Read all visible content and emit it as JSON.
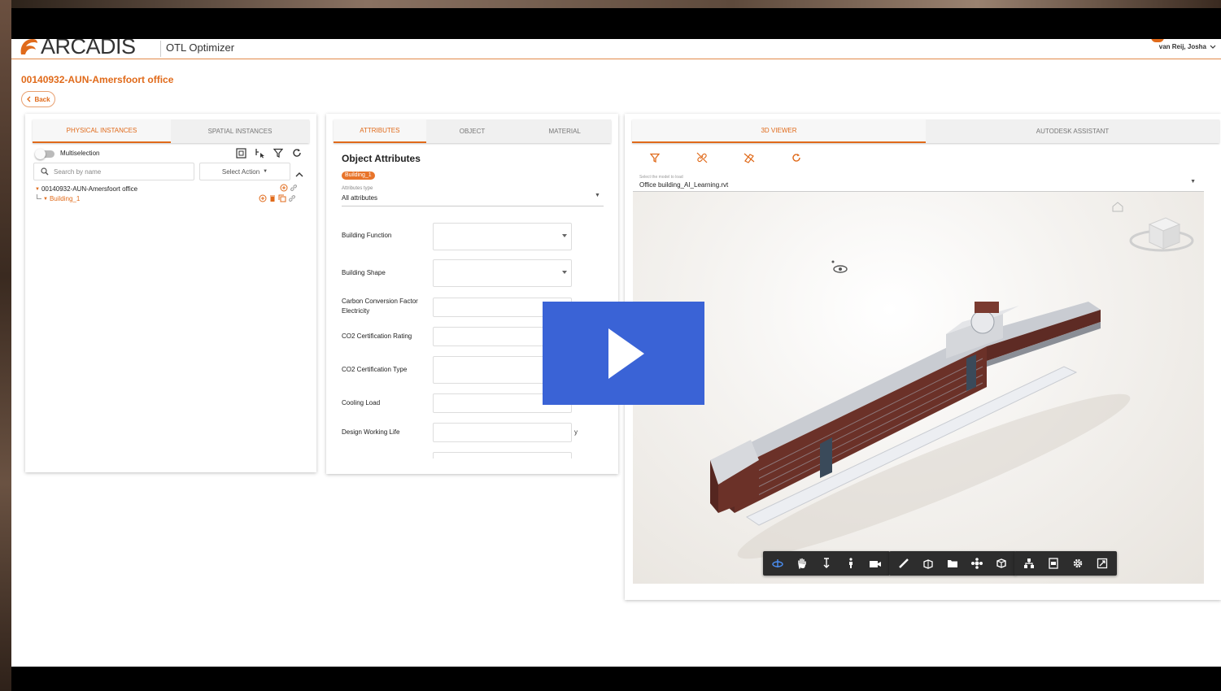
{
  "app": {
    "logo_text": "ARCADIS",
    "app_name": "OTL Optimizer",
    "user_name": "van Reij, Josha",
    "accent_color": "#e06a1a"
  },
  "page": {
    "title": "00140932-AUN-Amersfoort office",
    "back_label": "Back"
  },
  "instances_panel": {
    "tabs": [
      "PHYSICAL INSTANCES",
      "SPATIAL INSTANCES"
    ],
    "active_tab": "PHYSICAL INSTANCES",
    "multiselection_label": "Multiselection",
    "multiselection_on": false,
    "search_placeholder": "Search by name",
    "select_action_label": "Select Action",
    "tree": {
      "root": "00140932-AUN-Amersfoort office",
      "child": "Building_1"
    }
  },
  "attributes_panel": {
    "tabs": [
      "ATTRIBUTES",
      "OBJECT",
      "MATERIAL"
    ],
    "active_tab": "ATTRIBUTES",
    "title": "Object Attributes",
    "badge": "Building_1",
    "attributes_type_label": "Attributes type",
    "attributes_type_value": "All attributes",
    "fields": [
      {
        "label": "Building Function",
        "type": "select",
        "value": "",
        "unit": ""
      },
      {
        "label": "Building Shape",
        "type": "select",
        "value": "",
        "unit": ""
      },
      {
        "label": "Carbon Conversion Factor Electricity",
        "type": "input",
        "value": "",
        "unit": ""
      },
      {
        "label": "CO2 Certification Rating",
        "type": "input",
        "value": "",
        "unit": ""
      },
      {
        "label": "CO2 Certification Type",
        "type": "select",
        "value": "",
        "unit": ""
      },
      {
        "label": "Cooling Load",
        "type": "input",
        "value": "",
        "unit": "kWh"
      },
      {
        "label": "Design Working Life",
        "type": "input",
        "value": "",
        "unit": "y"
      }
    ]
  },
  "viewer_panel": {
    "tabs": [
      "3D VIEWER",
      "AUTODESK ASSISTANT"
    ],
    "active_tab": "3D VIEWER",
    "model_select_label": "Select the model to load",
    "model_select_value": "Office building_AI_Learning.rvt",
    "toolbar_icons": [
      "filter-icon",
      "unlink-icon",
      "hide-icon",
      "refresh-icon"
    ],
    "nav_groups": [
      [
        "orbit-icon",
        "pan-icon",
        "zoom-icon",
        "first-person-icon",
        "camera-icon"
      ],
      [
        "measure-icon",
        "section-icon",
        "explode-icon",
        "model-browser-icon",
        "properties-icon"
      ],
      [
        "structure-icon",
        "document-icon",
        "settings-icon",
        "fullscreen-icon"
      ]
    ]
  },
  "video_overlay": {
    "play_color": "#3a63d6"
  }
}
